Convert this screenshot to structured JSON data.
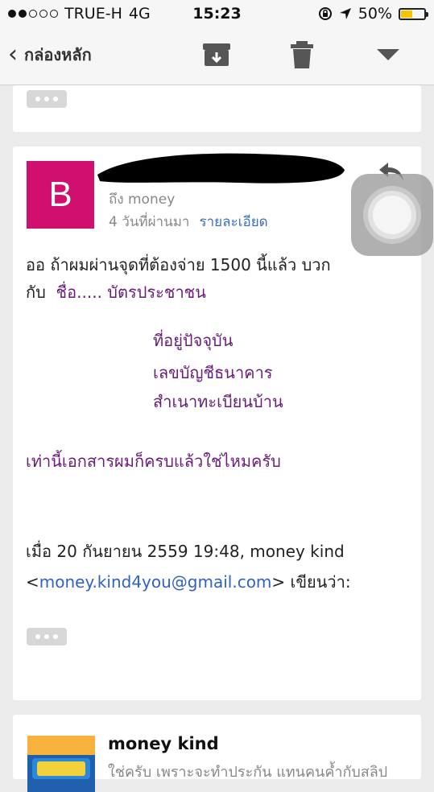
{
  "status_bar": {
    "carrier": "TRUE-H",
    "network": "4G",
    "time": "15:23",
    "battery_percent": "50%",
    "battery_level": 0.5,
    "battery_color": "#f5c400"
  },
  "nav": {
    "back_label": "กล่องหลัก",
    "icons": [
      "archive-icon",
      "trash-icon",
      "dropdown-icon"
    ]
  },
  "message": {
    "avatar_letter": "B",
    "avatar_color": "#d10f6f",
    "to_line": "ถึง money",
    "date": "4 วันที่ผ่านมา",
    "details_link": "รายละเอียด",
    "body": {
      "line1": "ออ ถ้าผมผ่านจุดที่ต้องจ่าย 1500 นี้แล้ว บวก",
      "line2_prefix": "กับ",
      "line2_purple": "ชื่อ..... บัตรประชาชน",
      "list": [
        "ที่อยู่ปัจจุบัน",
        "เลขบัญชีธนาคาร",
        "สำเนาทะเบียนบ้าน"
      ],
      "closing": "เท่านี้เอกสารผมก็ครบแล้วใช่ไหมครับ"
    },
    "quote": {
      "line1": "เมื่อ 20 กันยายน 2559 19:48, money kind",
      "email_open": "<",
      "email": "money.kind4you@gmail.com",
      "email_close": "> เขียนว่า:"
    }
  },
  "next_message": {
    "sender": "money kind",
    "snippet": "ใช่ครับ เพราะจะทำประกัน แทนคนค้ำกับสลิป"
  }
}
